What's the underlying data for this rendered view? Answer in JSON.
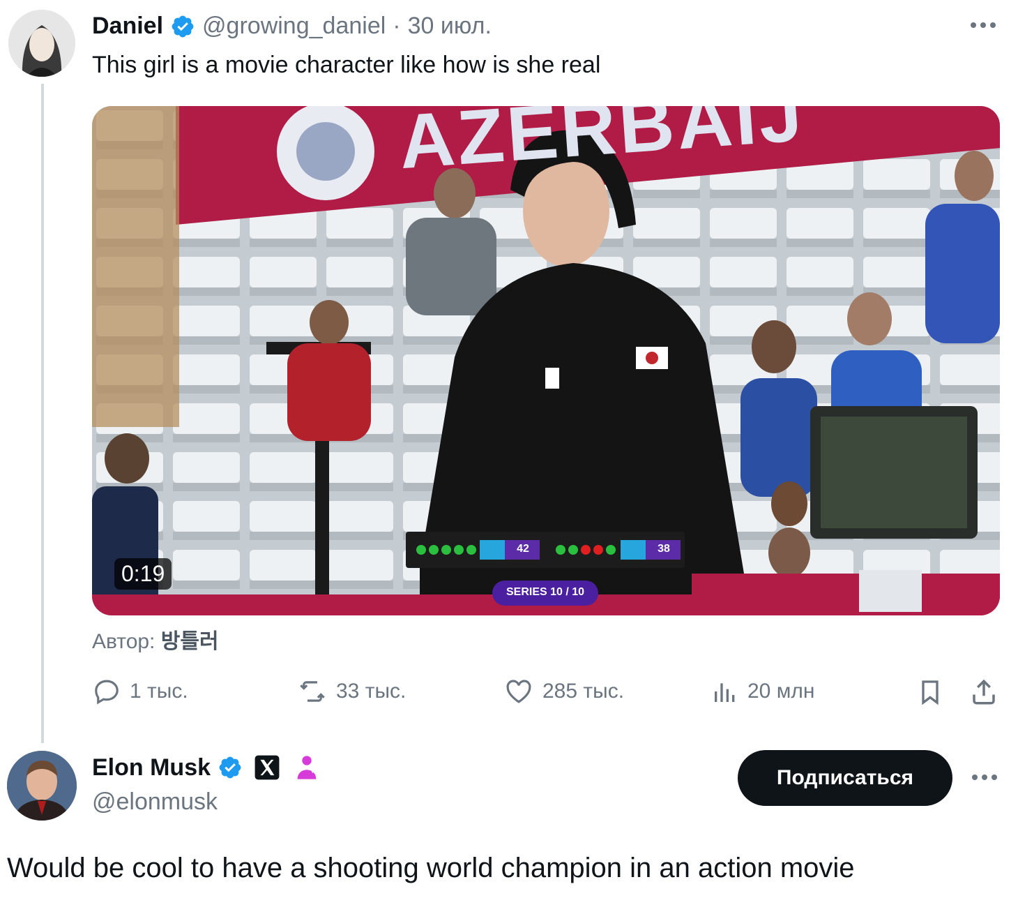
{
  "tweet": {
    "author_name": "Daniel",
    "handle": "@growing_daniel",
    "date": "30 июл.",
    "separator": "·",
    "text": "This girl is a movie character like how is she real",
    "video": {
      "duration": "0:19",
      "banner_text": "AZERBAIJ",
      "series_label": "SERIES 10 / 10",
      "score_left": "42",
      "score_right": "38"
    },
    "credit_label": "Автор:",
    "credit_name": "방틀러",
    "actions": {
      "replies": "1 тыс.",
      "reposts": "33 тыс.",
      "likes": "285 тыс.",
      "views": "20 млн"
    }
  },
  "reply": {
    "author_name": "Elon Musk",
    "handle": "@elonmusk",
    "follow_label": "Подписаться",
    "text": "Would be cool to have a shooting world champion in an action movie"
  },
  "colors": {
    "verified": "#1d9bf0",
    "follow_bg": "#0f1419",
    "muted": "#6b7580",
    "thread_line": "#cfd9de"
  }
}
